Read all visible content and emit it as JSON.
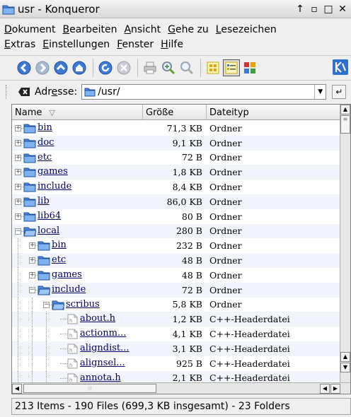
{
  "window": {
    "title": "usr - Konqueror",
    "buttons": [
      "↑",
      "▫",
      "□",
      "✕"
    ]
  },
  "menubar": {
    "row1": [
      {
        "first": "D",
        "rest": "okument"
      },
      {
        "first": "B",
        "rest": "earbeiten"
      },
      {
        "first": "A",
        "rest": "nsicht"
      },
      {
        "first": "G",
        "rest": "ehe zu"
      },
      {
        "first": "L",
        "rest": "esezeichen"
      }
    ],
    "row2": [
      {
        "first": "E",
        "rest": "xtras"
      },
      {
        "first": "E",
        "rest": "instellungen"
      },
      {
        "first": "F",
        "rest": "enster"
      },
      {
        "first": "H",
        "rest": "ilfe"
      }
    ]
  },
  "toolbar": {
    "buttons": [
      "back-icon",
      "forward-icon",
      "up-icon",
      "home-icon",
      "reload-icon",
      "stop-icon",
      "print-icon",
      "zoom-in-icon",
      "zoom-out-icon",
      "icon-view-icon",
      "detail-view-icon",
      "multicolumn-view-icon"
    ]
  },
  "location": {
    "label_first": "Adr",
    "label_ul": "e",
    "label_rest": "sse:",
    "value": "/usr/"
  },
  "columns": {
    "name": "Name",
    "size": "Größe",
    "type": "Dateityp"
  },
  "rows": [
    {
      "name": "bin",
      "size": "71,3 KB",
      "type": "Ordner",
      "depth": 0,
      "kind": "folder",
      "expanded": false
    },
    {
      "name": "doc",
      "size": "9,1 KB",
      "type": "Ordner",
      "depth": 0,
      "kind": "folder",
      "expanded": false
    },
    {
      "name": "etc",
      "size": "72 B",
      "type": "Ordner",
      "depth": 0,
      "kind": "folder",
      "expanded": false
    },
    {
      "name": "games",
      "size": "1,8 KB",
      "type": "Ordner",
      "depth": 0,
      "kind": "folder",
      "expanded": false
    },
    {
      "name": "include",
      "size": "8,4 KB",
      "type": "Ordner",
      "depth": 0,
      "kind": "folder",
      "expanded": false
    },
    {
      "name": "lib",
      "size": "86,0 KB",
      "type": "Ordner",
      "depth": 0,
      "kind": "folder",
      "expanded": false
    },
    {
      "name": "lib64",
      "size": "80 B",
      "type": "Ordner",
      "depth": 0,
      "kind": "folder",
      "expanded": false
    },
    {
      "name": "local",
      "size": "280 B",
      "type": "Ordner",
      "depth": 0,
      "kind": "folder",
      "expanded": true
    },
    {
      "name": "bin",
      "size": "232 B",
      "type": "Ordner",
      "depth": 1,
      "kind": "folder",
      "expanded": false
    },
    {
      "name": "etc",
      "size": "48 B",
      "type": "Ordner",
      "depth": 1,
      "kind": "folder",
      "expanded": false
    },
    {
      "name": "games",
      "size": "48 B",
      "type": "Ordner",
      "depth": 1,
      "kind": "folder",
      "expanded": false
    },
    {
      "name": "include",
      "size": "72 B",
      "type": "Ordner",
      "depth": 1,
      "kind": "folder",
      "expanded": true
    },
    {
      "name": "scribus",
      "size": "5,8 KB",
      "type": "Ordner",
      "depth": 2,
      "kind": "folder",
      "expanded": true
    },
    {
      "name": "about.h",
      "size": "1,2 KB",
      "type": "C++-Headerdatei",
      "depth": 3,
      "kind": "file"
    },
    {
      "name": "actionm...",
      "size": "4,1 KB",
      "type": "C++-Headerdatei",
      "depth": 3,
      "kind": "file"
    },
    {
      "name": "aligndist...",
      "size": "3,1 KB",
      "type": "C++-Headerdatei",
      "depth": 3,
      "kind": "file"
    },
    {
      "name": "alignsel...",
      "size": "925 B",
      "type": "C++-Headerdatei",
      "depth": 3,
      "kind": "file"
    },
    {
      "name": "annota.h",
      "size": "2,1 KB",
      "type": "C++-Headerdatei",
      "depth": 3,
      "kind": "file"
    }
  ],
  "status": {
    "text": "213 Items - 190 Files (699,3 KB insgesamt) - 23 Folders"
  },
  "colors": {
    "folder": "#3a7bd5",
    "link": "#000064",
    "alt_row": "#f1f5fb"
  }
}
